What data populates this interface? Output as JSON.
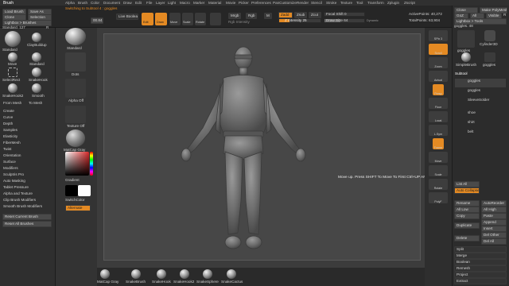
{
  "app": {
    "name": "ZBrush"
  },
  "menubar": {
    "items": [
      "Alpha",
      "Brush",
      "Color",
      "Document",
      "Draw",
      "Edit",
      "File",
      "Layer",
      "Light",
      "Macro",
      "Marker",
      "Material",
      "Movie",
      "Picker",
      "Preferences",
      "PanCustomize",
      "Render",
      "Stencil",
      "Stroke",
      "Texture",
      "Tool",
      "Transform",
      "Zplugin",
      "Zscript"
    ],
    "right_items": [
      "Close",
      "Make PolyMesh3D"
    ]
  },
  "topbar": {
    "brush_label": "Brush",
    "subtool_path": "Switching to Subtool 4 : goggles",
    "live_boolean": "Live Boolean",
    "edit_mode": {
      "edit": "Edit",
      "draw": "Draw",
      "move": "Move",
      "scale": "Scale",
      "rotate": "Rotate"
    },
    "mrgb": "Mrgb",
    "rgb": "Rgb",
    "m": "M",
    "rgb_intensity": "Rgb Intensity",
    "zadd": "Zadd",
    "zsub": "Zsub",
    "zcut": "Zcut",
    "z_intensity": "Z Intensity 25",
    "focal_shift": "Focal Shift 0",
    "draw_size": "Draw Size 64",
    "dynamic": "Dynamic",
    "active_points": "ActivePoints: 40,272",
    "total_points": "TotalPoints: 63,904",
    "small_btn": "00.84"
  },
  "left_panel": {
    "buttons": [
      "Load Brush",
      "Save As",
      "Clone",
      "Selection",
      "Lightbox > Brushes"
    ],
    "standard_label": "Standard. 127",
    "r_label": "R",
    "brushes": [
      "Standard",
      "ClayBuildup",
      "Move",
      "Standard",
      "SelectRect",
      "SnakeHook",
      "SnakeHook2",
      "Smooth"
    ],
    "from_mesh": "From Mesh",
    "to_mesh": "To Mesh",
    "sections": [
      "Create",
      "Curve",
      "Depth",
      "Samples",
      "Elasticity",
      "FiberMesh",
      "Twist",
      "Orientation",
      "Surface",
      "Modifiers",
      "Sculptris Pro",
      "Auto Masking",
      "Tablet Pressure",
      "Alpha and Texture",
      "Clip Brush Modifiers",
      "Smooth Brush Modifiers"
    ],
    "reset_current": "Reset Current Brush",
    "reset_all": "Reset All Brushes"
  },
  "tool_column": {
    "standard": "Standard",
    "dots": "Dots",
    "alpha_off": "Alpha Off",
    "texture_off": "Texture Off",
    "material": "MatCap Gray",
    "gradient": "Gradient",
    "switch_color": "SwitchColor",
    "alternate": "Alternate",
    "picker_color": "#d92a2a"
  },
  "viewport": {
    "tooltip": "Move up. Press SHIFT To Move To First  Ctrl+UP ARROW"
  },
  "right_dock": {
    "items": [
      "SPix 3",
      "Scroll",
      "Zoom",
      "Actual",
      "AAHalf",
      "Persp",
      "Floor",
      "Local",
      "L.Sym",
      "Frame",
      "Move",
      "Scale",
      "Rotate",
      "PolyF",
      "Transp",
      "Ghost",
      "Solo"
    ]
  },
  "right_panel": {
    "top_buttons": [
      "Close",
      "Make PolyMesh3D",
      "GoZ",
      "All",
      "Visible",
      "R",
      "Lightbox > Tools"
    ],
    "goggles_count": "goggles. 48",
    "tools": [
      "goggles",
      "Cylinder3D",
      "SimpleBrush",
      "goggles"
    ],
    "subtool_header": "Subtool",
    "subtools": [
      "goggles",
      "goggles",
      "SleeveSolder",
      "shoe",
      "shirt",
      "belt"
    ],
    "list_all": "List All",
    "auto_collapse": "Auto Collapse",
    "rename": "Rename",
    "auto_reorder": "AutoReorder",
    "all_low": "All Low",
    "all_high": "All High",
    "copy": "Copy",
    "paste": "Paste",
    "duplicate": "Duplicate",
    "append": "Append",
    "insert": "Insert",
    "delete": "Delete",
    "del_other": "Del Other",
    "del_all": "Del All",
    "split": "Split",
    "merge": "Merge",
    "boolean": "Boolean",
    "remesh": "Remesh",
    "project": "Project",
    "extract": "Extract"
  },
  "bottom_shelf": {
    "items": [
      "MatCap Gray",
      "SnakeBrush",
      "SnakeHook",
      "SnakeHook2",
      "SnakeSphere",
      "SnakeCactus"
    ]
  }
}
